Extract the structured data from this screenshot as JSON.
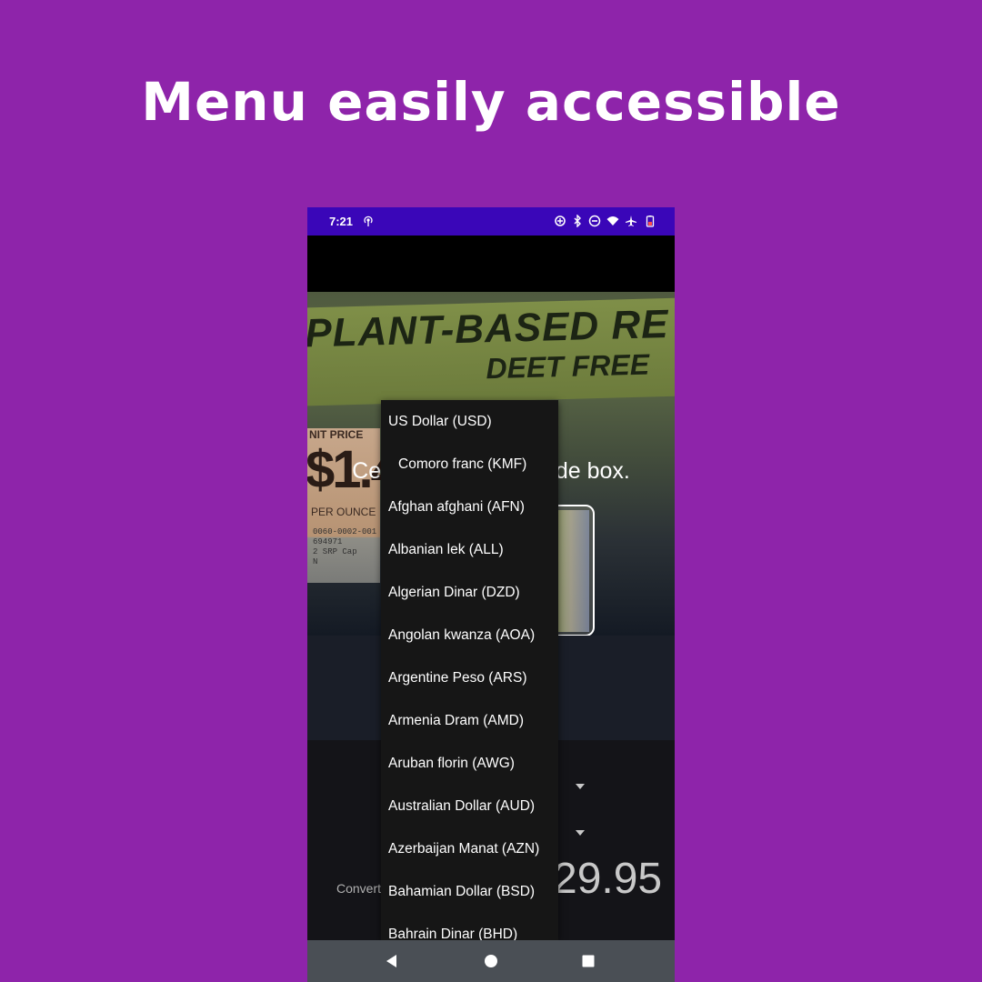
{
  "headline": "Menu easily accessible",
  "status_bar": {
    "time": "7:21",
    "icons": [
      "radio-tower-icon",
      "data-saver-icon",
      "bluetooth-icon",
      "do-not-disturb-icon",
      "wifi-icon",
      "airplane-icon",
      "battery-low-icon"
    ]
  },
  "camera": {
    "hint": "Center numbers inside box.",
    "label_big": "PLANT-BASED RE",
    "label_small": "DEET FREE",
    "tag_unit": "NIT PRICE",
    "tag_price": "$1.47",
    "tag_per": "PER OUNCE",
    "tag_code_1": "0060-0002-001",
    "tag_code_2": "694971",
    "tag_code_3": "2 SRP Cap",
    "tag_code_4": "N"
  },
  "converter": {
    "convert_label": "Convert",
    "amount": "29.95"
  },
  "currency_menu": {
    "items": [
      "US Dollar (USD)",
      "Comoro franc (KMF)",
      "Afghan afghani (AFN)",
      "Albanian lek (ALL)",
      "Algerian Dinar (DZD)",
      "Angolan kwanza (AOA)",
      "Argentine Peso (ARS)",
      "Armenia Dram (AMD)",
      "Aruban florin (AWG)",
      "Australian Dollar (AUD)",
      "Azerbaijan Manat (AZN)",
      "Bahamian Dollar (BSD)",
      "Bahrain Dinar (BHD)"
    ]
  },
  "nav_bar": {
    "buttons": [
      "back-icon",
      "home-icon",
      "recents-icon"
    ]
  },
  "colors": {
    "background": "#8e24aa",
    "status_bar": "#3a06b8",
    "menu_bg": "#161616",
    "nav_bar": "#4a4f55"
  }
}
